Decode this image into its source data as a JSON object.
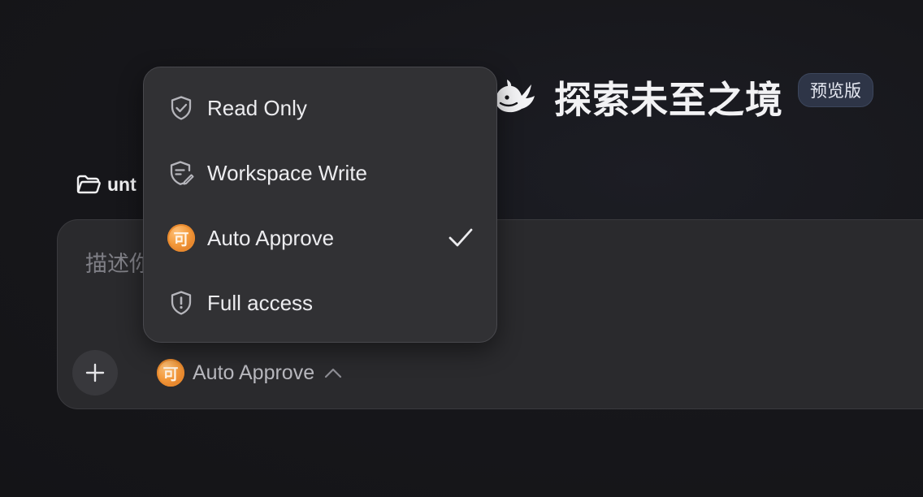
{
  "brand": {
    "logo_icon": "whale-logo-icon",
    "title": "探索未至之境",
    "badge": "预览版"
  },
  "folder": {
    "icon": "folder-open-icon",
    "name": "unt"
  },
  "composer": {
    "placeholder": "描述你",
    "add_icon": "plus-icon",
    "mode_selector": {
      "icon_glyph": "可",
      "label": "Auto Approve",
      "chevron_icon": "chevron-up-icon"
    }
  },
  "menu": {
    "items": [
      {
        "label": "Read Only",
        "icon": "shield-check-icon",
        "selected": false
      },
      {
        "label": "Workspace Write",
        "icon": "shield-edit-icon",
        "selected": false
      },
      {
        "label": "Auto Approve",
        "icon": "approve-coin-icon",
        "icon_glyph": "可",
        "selected": true
      },
      {
        "label": "Full access",
        "icon": "shield-alert-icon",
        "selected": false
      }
    ],
    "check_icon": "checkmark-icon"
  },
  "colors": {
    "background": "#16161a",
    "panel": "#2a2a2d",
    "menu": "#313134",
    "badge": "#2e3547",
    "accent_coin": "#f39a3c"
  }
}
